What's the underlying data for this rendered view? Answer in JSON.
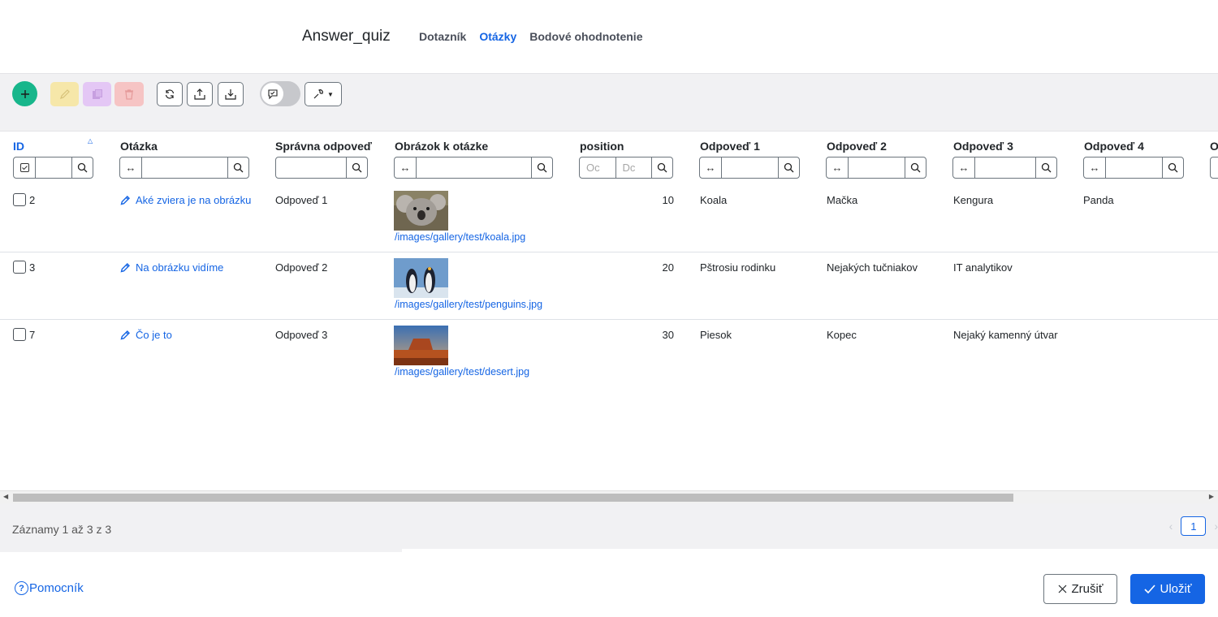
{
  "app": {
    "title": "Answer_quiz"
  },
  "tabs": [
    {
      "label": "Dotazník",
      "active": false
    },
    {
      "label": "Otázky",
      "active": true
    },
    {
      "label": "Bodové ohodnotenie",
      "active": false
    }
  ],
  "toolbar": {
    "icons": [
      "plus-icon",
      "pencil-icon",
      "copy-icon",
      "trash-icon",
      "refresh-icon",
      "export-icon",
      "import-icon",
      "comment-toggle-icon",
      "wrench-icon"
    ]
  },
  "table": {
    "columns": {
      "id": "ID",
      "question": "Otázka",
      "correct": "Správna odpoveď",
      "image": "Obrázok k otázke",
      "position": "position",
      "answer1": "Odpoveď 1",
      "answer2": "Odpoveď 2",
      "answer3": "Odpoveď 3",
      "answer4": "Odpoveď 4",
      "answer5": "O"
    },
    "filters": {
      "range_symbol": "↔",
      "position_from_placeholder": "Oc",
      "position_to_placeholder": "Dc"
    },
    "rows": [
      {
        "id": "2",
        "question": "Aké zviera je na obrázku",
        "correct": "Odpoveď 1",
        "image": "/images/gallery/test/koala.jpg",
        "position": "10",
        "answer1": "Koala",
        "answer2": "Mačka",
        "answer3": "Kengura",
        "answer4": "Panda"
      },
      {
        "id": "3",
        "question": "Na obrázku vidíme",
        "correct": "Odpoveď 2",
        "image": "/images/gallery/test/penguins.jpg",
        "position": "20",
        "answer1": "Pštrosiu rodinku",
        "answer2": "Nejakých tučniakov",
        "answer3": "IT analytikov",
        "answer4": ""
      },
      {
        "id": "7",
        "question": "Čo je to",
        "correct": "Odpoveď 3",
        "image": "/images/gallery/test/desert.jpg",
        "position": "30",
        "answer1": "Piesok",
        "answer2": "Kopec",
        "answer3": "Nejaký kamenný útvar",
        "answer4": ""
      }
    ]
  },
  "footer": {
    "records": "Záznamy 1 až 3 z 3",
    "page": "1"
  },
  "actions": {
    "help": "Pomocník",
    "cancel": "Zrušiť",
    "save": "Uložiť"
  },
  "colors": {
    "primary": "#1565e4",
    "add": "#18b68b",
    "edit": "#f6e7a9",
    "duplicate": "#e4c7f5",
    "delete": "#f6c4c4"
  }
}
